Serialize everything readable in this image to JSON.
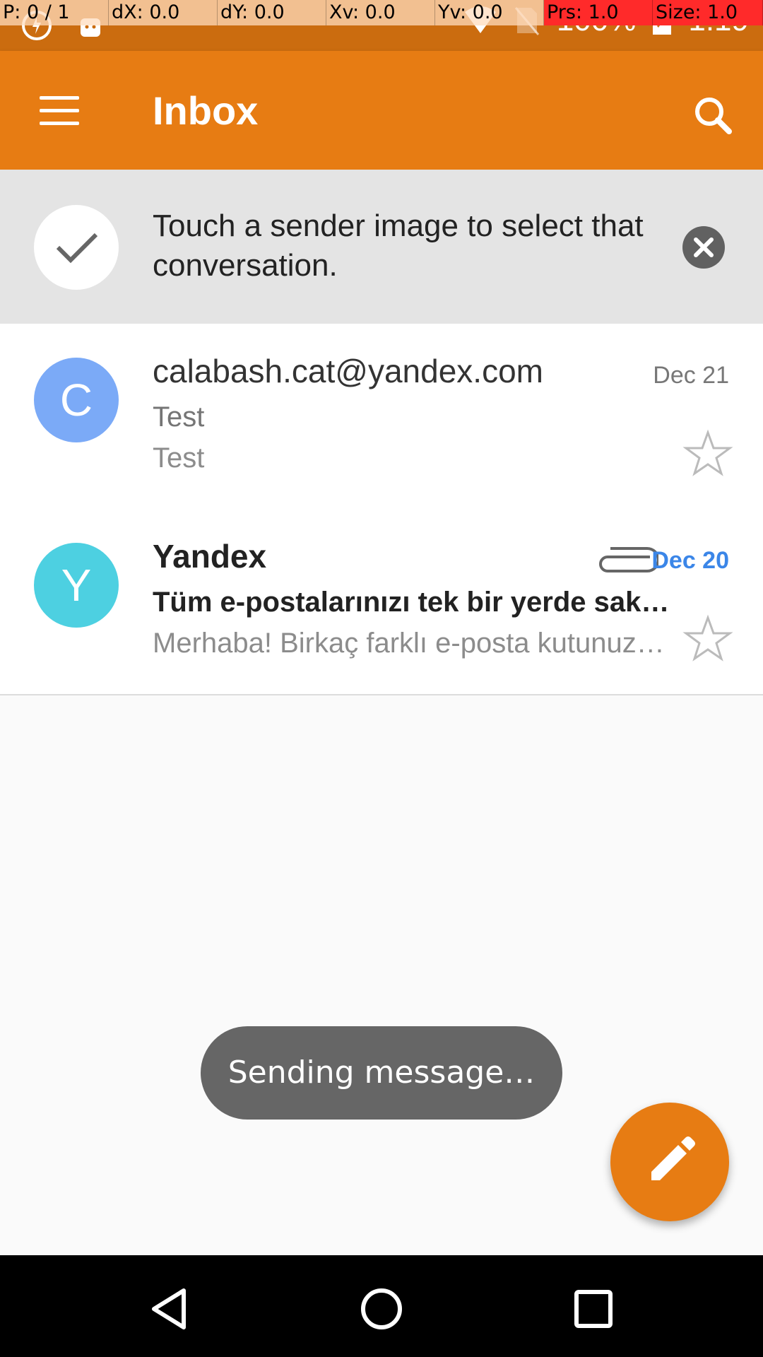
{
  "status_bar": {
    "debug": {
      "pointer": "P: 0 / 1",
      "dx": "dX: 0.0",
      "dy": "dY: 0.0",
      "xv": "Xv: 0.0",
      "yv": "Yv: 0.0",
      "prs": "Prs: 1.0",
      "size": "Size: 1.0"
    },
    "battery": "100%",
    "time": "1:19"
  },
  "app_bar": {
    "title": "Inbox",
    "menu_icon": "menu-icon",
    "search_icon": "search-icon",
    "color": "#e77c13"
  },
  "tip": {
    "text": "Touch a sender image to select that conversation."
  },
  "conversations": [
    {
      "avatar_letter": "C",
      "avatar_color": "#7baaf7",
      "sender": "calabash.cat@yandex.com",
      "date": "Dec 21",
      "subject": "Test",
      "snippet": "Test",
      "unread": false,
      "attachment": false
    },
    {
      "avatar_letter": "Y",
      "avatar_color": "#4dd0e1",
      "sender": "Yandex",
      "date": "Dec 20",
      "subject": "Tüm e-postalarınızı tek bir yerde sakl…",
      "snippet": "Merhaba! Birkaç farklı e-posta kutunuz…",
      "unread": true,
      "attachment": true
    }
  ],
  "toast": {
    "text": "Sending message…"
  },
  "fab": {
    "icon": "pencil-icon"
  }
}
